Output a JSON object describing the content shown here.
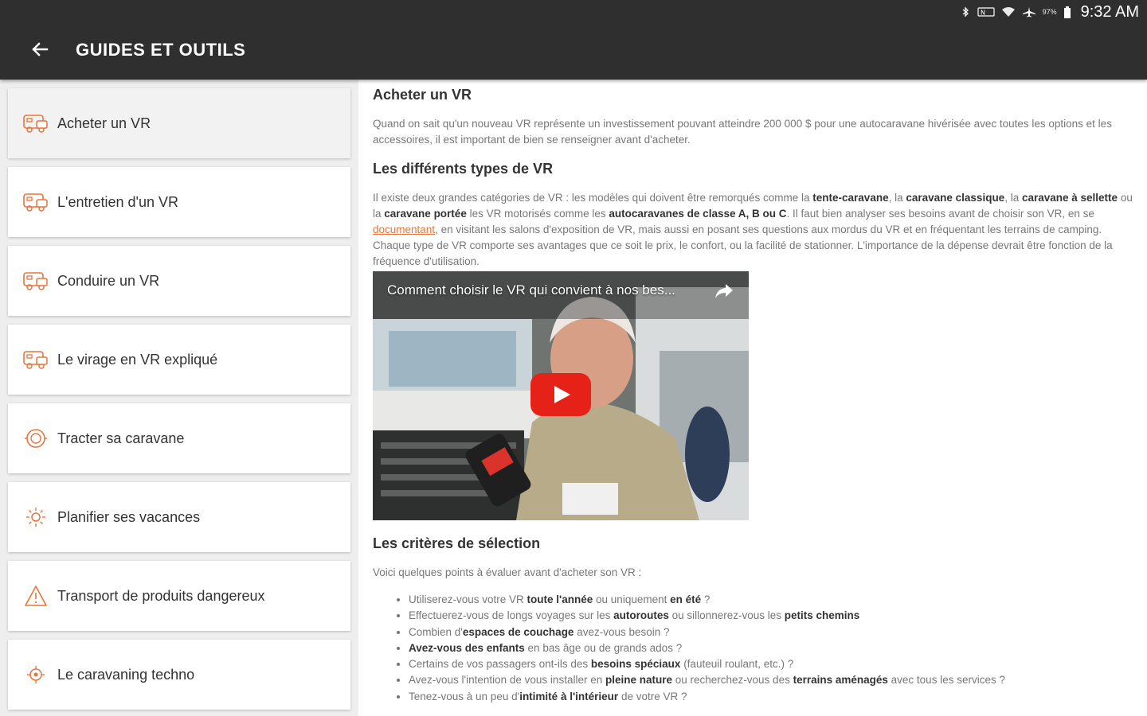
{
  "status_bar": {
    "icons": [
      "bluetooth-icon",
      "nfc-icon",
      "wifi-icon",
      "airplane-icon",
      "battery-icon"
    ],
    "battery_text": "97%",
    "time": "9:32 AM"
  },
  "app_bar": {
    "back_icon": "arrow-left-icon",
    "title": "GUIDES ET OUTILS",
    "background": "#2f2f2f"
  },
  "accent_color": "#e8743b",
  "sidebar": {
    "items": [
      {
        "label": "Acheter un VR",
        "icon": "rv-icon",
        "selected": true
      },
      {
        "label": "L'entretien d'un VR",
        "icon": "rv-icon"
      },
      {
        "label": "Conduire un VR",
        "icon": "rv-icon"
      },
      {
        "label": "Le virage en VR expliqué",
        "icon": "rv-icon"
      },
      {
        "label": "Tracter sa caravane",
        "icon": "tow-hitch-icon"
      },
      {
        "label": "Planifier ses vacances",
        "icon": "sun-icon"
      },
      {
        "label": "Transport de produits dangereux",
        "icon": "warning-triangle-icon"
      },
      {
        "label": "Le caravaning techno",
        "icon": "gps-icon"
      }
    ]
  },
  "article": {
    "heading": "Acheter un VR",
    "intro": "Quand on sait qu'un nouveau VR représente un investissement pouvant atteindre 200 000 $ pour une autocaravane hivérisée avec toutes les options et les accessoires, il est important de bien se renseigner avant d'acheter.",
    "types_heading": "Les différents types de VR",
    "types_paragraph": {
      "t1": "Il existe deux grandes catégories de VR : les modèles qui doivent être remorqués comme la ",
      "k1": "tente-caravane",
      "t2": ", la ",
      "k2": "caravane classique",
      "t3": ", la ",
      "k3": "caravane à sellette",
      "t4": " ou la ",
      "k4": "caravane portée",
      "t5": " les VR motorisés comme les ",
      "k5": "autocaravanes de classe A, B ou C",
      "t6": ". Il faut bien analyser ses besoins avant de choisir son VR, en se ",
      "link": "documentant",
      "t7": ", en visitant les salons d'exposition de VR, mais aussi en posant ses questions aux mordus du VR et en fréquentant les terrains de camping. Chaque type de VR comporte ses avantages que ce soit le prix, le confort, ou la facilité de stationner. L'importance de la dépense devrait être fonction de la fréquence d'utilisation."
    },
    "video": {
      "title": "Comment choisir le VR qui convient à nos bes...",
      "share_icon": "share-icon",
      "play_icon": "youtube-play-icon"
    },
    "criteria_heading": "Les critères de sélection",
    "criteria_intro": "Voici quelques points à évaluer avant d'acheter son VR :",
    "criteria": [
      {
        "a": "Utiliserez-vous votre VR ",
        "b": "toute l'année",
        "c": " ou uniquement ",
        "d": "en été",
        "e": " ?"
      },
      {
        "a": "Effectuerez-vous de longs voyages sur les ",
        "b": "autoroutes",
        "c": " ou sillonnerez-vous les ",
        "d": "petits chemins",
        "e": ""
      },
      {
        "a": "Combien d'",
        "b": "espaces de couchage",
        "c": " avez-vous besoin ?",
        "d": "",
        "e": ""
      },
      {
        "a": "",
        "b": "Avez-vous des enfants",
        "c": " en bas âge ou de grands ados ?",
        "d": "",
        "e": ""
      },
      {
        "a": "Certains de vos passagers ont-ils des ",
        "b": "besoins spéciaux",
        "c": " (fauteuil roulant, etc.) ?",
        "d": "",
        "e": ""
      },
      {
        "a": "Avez-vous l'intention de vous installer en ",
        "b": "pleine nature",
        "c": " ou recherchez-vous des ",
        "d": "terrains aménagés",
        "e": " avec tous les services ?"
      },
      {
        "a": "Tenez-vous à un peu d'",
        "b": "intimité à l'intérieur",
        "c": " de votre VR ?",
        "d": "",
        "e": ""
      }
    ]
  }
}
